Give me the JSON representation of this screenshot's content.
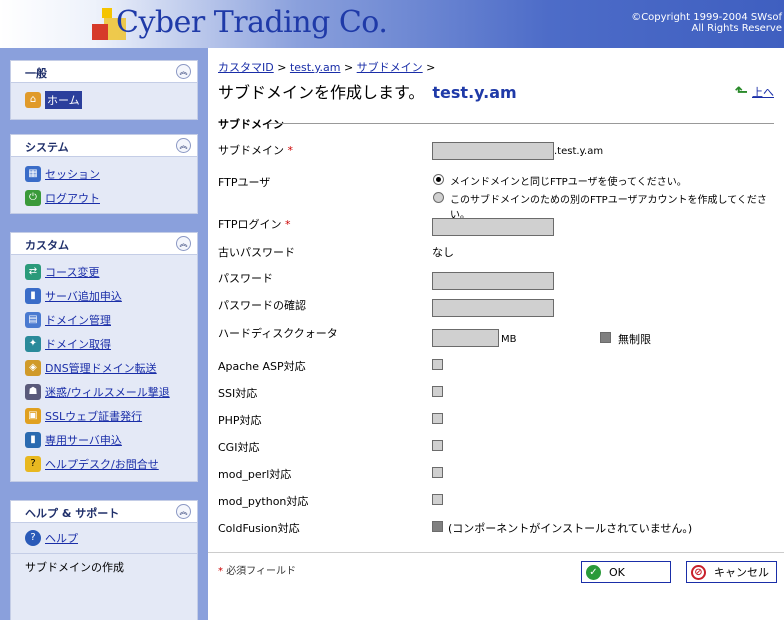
{
  "header": {
    "logo_text": "Cyber Trading Co.",
    "copyright_line1": "©Copyright 1999-2004 SWsof",
    "copyright_line2": "All Rights Reserve"
  },
  "sidebar": {
    "general": {
      "title": "一般",
      "items": [
        {
          "label": "ホーム",
          "icon": "home-icon"
        }
      ]
    },
    "system": {
      "title": "システム",
      "items": [
        {
          "label": "セッション",
          "icon": "sessions-icon"
        },
        {
          "label": "ログアウト",
          "icon": "logout-icon"
        }
      ]
    },
    "custom": {
      "title": "カスタム",
      "items": [
        {
          "label": "コース変更",
          "icon": "course-change-icon"
        },
        {
          "label": "サーバ追加申込",
          "icon": "server-add-icon"
        },
        {
          "label": "ドメイン管理",
          "icon": "domain-manage-icon"
        },
        {
          "label": "ドメイン取得",
          "icon": "domain-get-icon"
        },
        {
          "label": "DNS管理ドメイン転送",
          "icon": "dns-icon"
        },
        {
          "label": "迷惑/ウィルスメール撃退",
          "icon": "antispam-icon"
        },
        {
          "label": "SSLウェブ証書発行",
          "icon": "ssl-icon"
        },
        {
          "label": "専用サーバ申込",
          "icon": "dedicated-server-icon"
        },
        {
          "label": "ヘルプデスク/お問合せ",
          "icon": "helpdesk-icon"
        }
      ]
    },
    "help": {
      "title": "ヘルプ & サポート",
      "items": [
        {
          "label": "ヘルプ",
          "icon": "help-icon"
        }
      ],
      "context": "サブドメインの作成"
    }
  },
  "main": {
    "breadcrumb": [
      "カスタマID",
      "test.y.am",
      "サブドメイン"
    ],
    "breadcrumb_sep": " > ",
    "title": "サブドメインを作成します。",
    "title_domain": "test.y.am",
    "up_label": "上へ",
    "section_title": "サブドメイン",
    "fields": {
      "subdomain_label": "サブドメイン",
      "subdomain_suffix": ".test.y.am",
      "ftp_user_label": "FTPユーザ",
      "ftp_opt1": "メインドメインと同じFTPユーザを使ってください。",
      "ftp_opt2": "このサブドメインのための別のFTPユーザアカウントを作成してください。",
      "ftp_login_label": "FTPログイン",
      "old_password_label": "古いパスワード",
      "old_password_value": "なし",
      "password_label": "パスワード",
      "password_confirm_label": "パスワードの確認",
      "quota_label": "ハードディスククォータ",
      "quota_unit": "MB",
      "unlimited_label": "無制限",
      "asp_label": "Apache ASP対応",
      "ssi_label": "SSI対応",
      "php_label": "PHP対応",
      "cgi_label": "CGI対応",
      "mod_perl_label": "mod_perl対応",
      "mod_python_label": "mod_python対応",
      "coldfusion_label": "ColdFusion対応",
      "coldfusion_note": "(コンポーネントがインストールされていません。)"
    },
    "required_star": "*",
    "required_note": "必須フィールド",
    "ok_label": "OK",
    "cancel_label": "キャンセル"
  }
}
